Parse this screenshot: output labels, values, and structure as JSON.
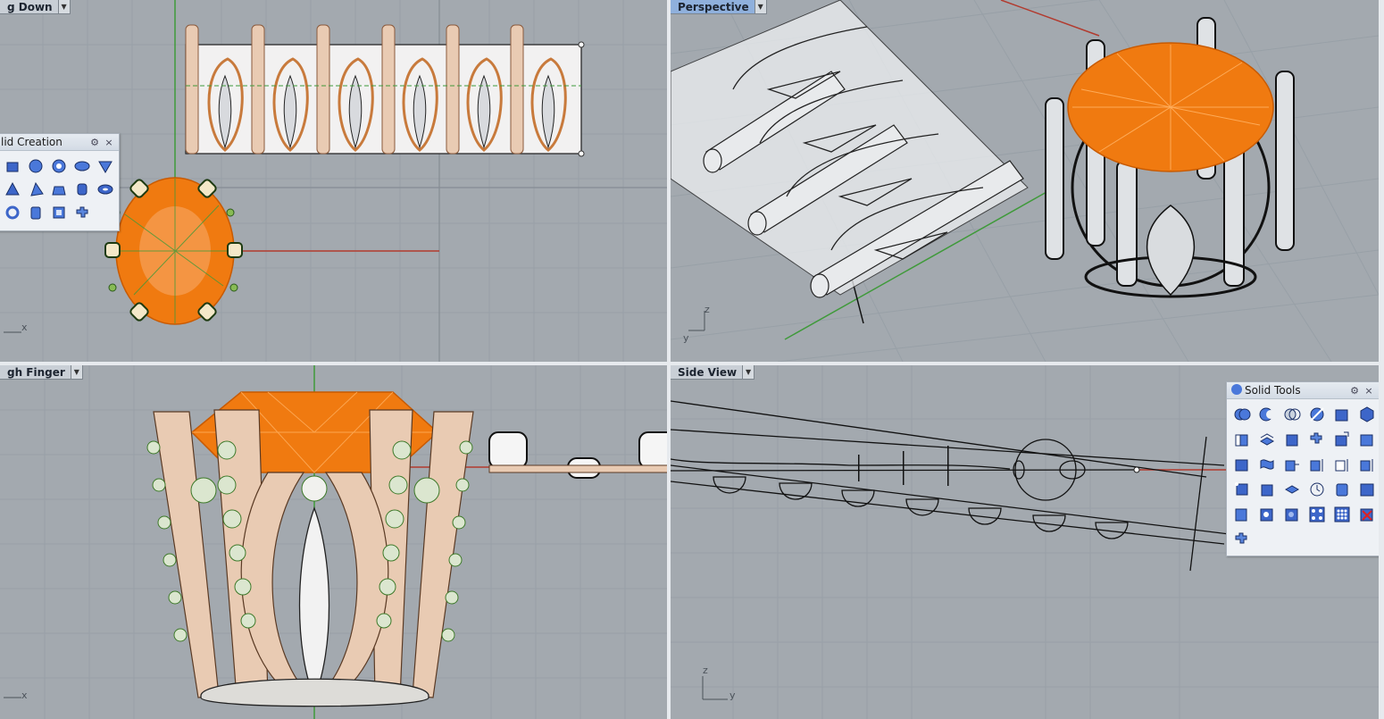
{
  "viewports": {
    "top_left": {
      "title": "g Down"
    },
    "top_right": {
      "title": "Perspective"
    },
    "bottom_left": {
      "title": "gh Finger"
    },
    "bottom_right": {
      "title": "Side View"
    }
  },
  "axes": {
    "top_left": {
      "x": "x"
    },
    "top_right": {
      "y": "y",
      "z": "z"
    },
    "bottom_left": {
      "x": "x"
    },
    "bottom_right": {
      "y": "y",
      "z": "z"
    }
  },
  "panels": {
    "solid_creation": {
      "title": "lid Creation",
      "settings_icon": "gear-icon",
      "close_label": "×"
    },
    "solid_tools": {
      "title": "Solid Tools",
      "settings_icon": "gear-icon",
      "close_label": "×"
    }
  },
  "colors": {
    "viewport_bg": "#a3a9af",
    "active_title": "#8fb0dc",
    "gem_orange": "#f07a10",
    "metal": "#e9cbb3",
    "grid_major": "#8f959b",
    "x_axis": "#b23b2f",
    "y_axis": "#3f9a3a"
  }
}
